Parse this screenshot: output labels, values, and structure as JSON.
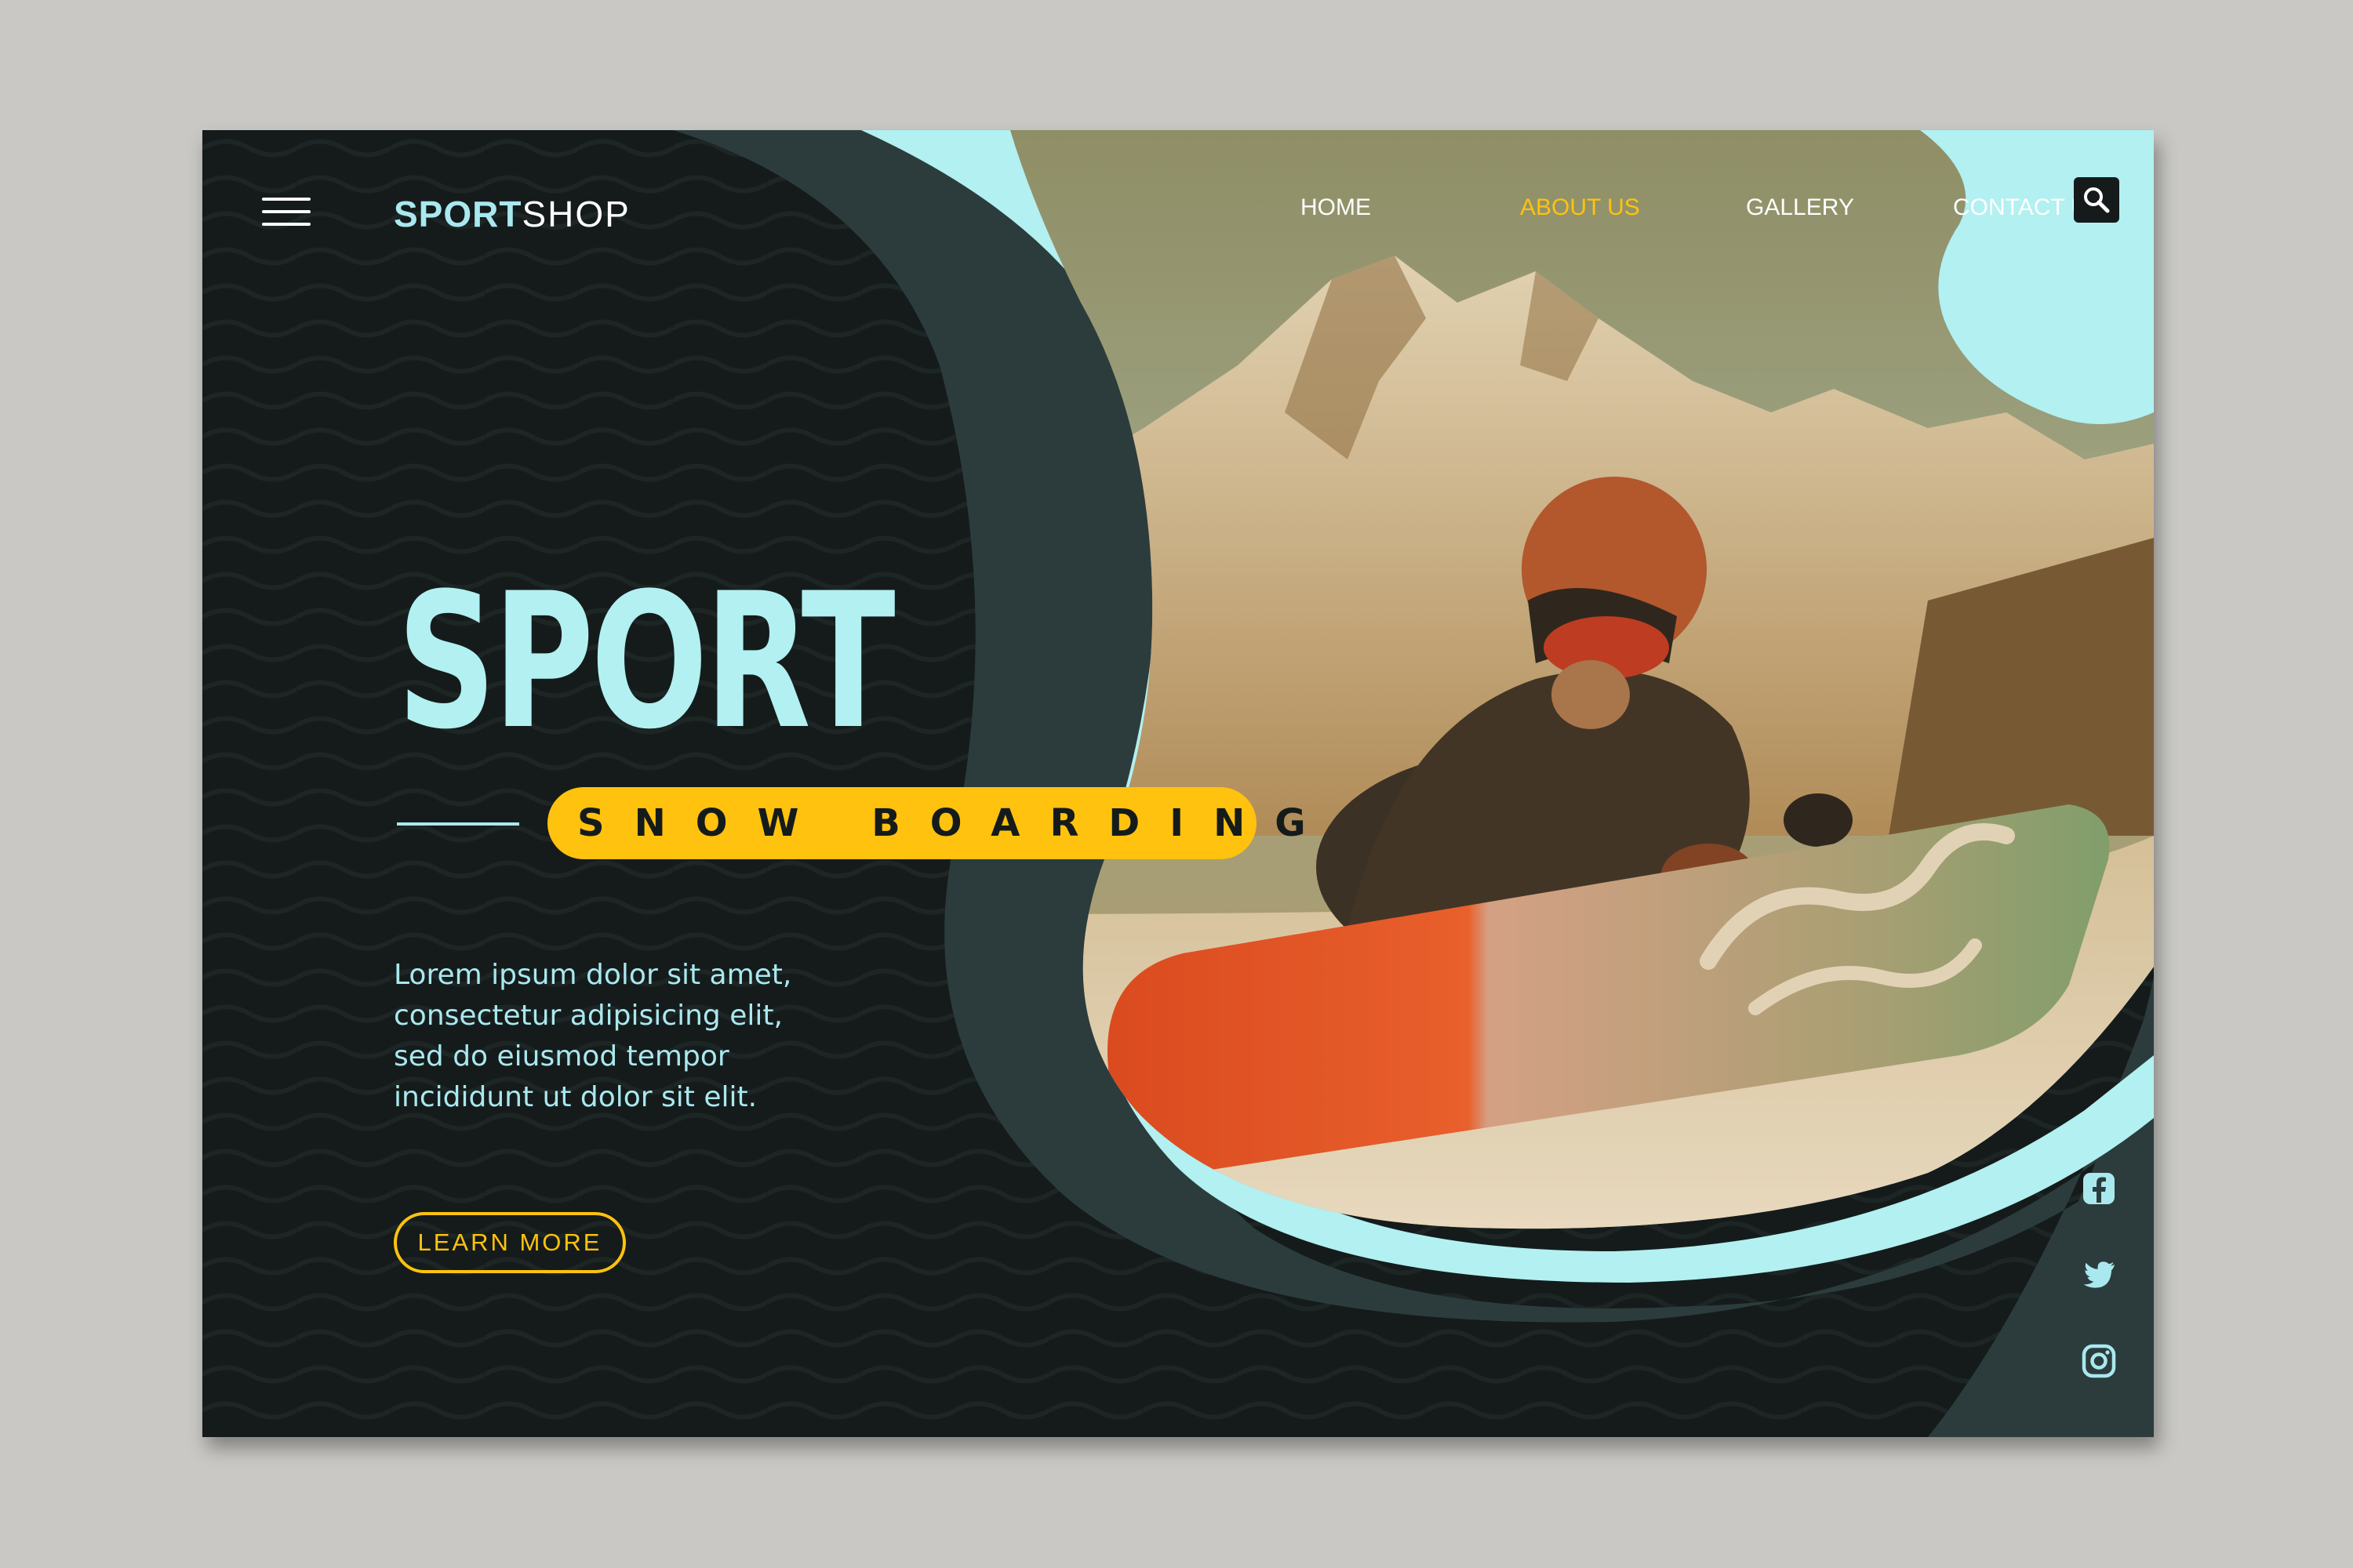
{
  "header": {
    "logo_part1": "SPORT",
    "logo_part2": "SHOP",
    "nav": [
      {
        "label": "HOME",
        "active": false
      },
      {
        "label": "ABOUT US",
        "active": true
      },
      {
        "label": "GALLERY",
        "active": false
      },
      {
        "label": "CONTACT US",
        "active": false
      }
    ]
  },
  "hero": {
    "title": "SPORT",
    "subtitle": "SNOW BOARDING",
    "description": [
      "Lorem ipsum dolor sit amet,",
      "consectetur adipisicing elit,",
      "sed do eiusmod tempor",
      "incididunt ut dolor sit elit."
    ],
    "cta_label": "LEARN MORE"
  },
  "icons": {
    "menu": "hamburger-menu-icon",
    "search": "search-icon",
    "social": [
      "facebook-icon",
      "twitter-icon",
      "instagram-icon"
    ]
  },
  "colors": {
    "background_dark": "#151b1b",
    "accent_cyan": "#a9e8ef",
    "accent_yellow": "#ffc20e",
    "mockup_gray": "#c9c8c4"
  }
}
